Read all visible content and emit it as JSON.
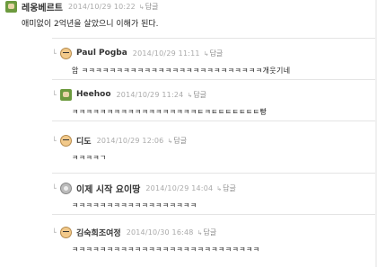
{
  "comments": {
    "top": {
      "nickname": "레옹베르트",
      "time": "2014/10/29 10:22",
      "reply_label": "답글",
      "text": "애미없이 2억년을 살았으니 이해가 된다."
    },
    "replies": [
      {
        "nickname": "Paul Pogba",
        "time": "2014/10/29 11:11",
        "reply_label": "답글",
        "text": "암 ㅋㅋㅋㅋㅋㅋㅋㅋㅋㅋㅋㅋㅋㅋㅋㅋㅋㅋㅋㅋㅋㅋㅋㅋㅋㅋ개웃기네"
      },
      {
        "nickname": "Heehoo",
        "time": "2014/10/29 11:24",
        "reply_label": "답글",
        "text": "ㅋㅋㅋㅋㅋㅋㅋㅋㅋㅋㅋㅋㅋㅋㅋㅋㅋㅋㅌㅋㅌㅌㅌㅌㅌㅌㅌ빵"
      },
      {
        "nickname": "디도",
        "time": "2014/10/29 12:06",
        "reply_label": "답글",
        "text": "ㅋㅋㅋㅋㄱ"
      },
      {
        "nickname": "이제 시작 요이땅",
        "time": "2014/10/29 14:04",
        "reply_label": "답글",
        "text": "ㅋㅋㅋㅋㅋㅋㅋㅋㅋㅋㅋㅋㅋㅋㅋㅋㅋㅋ"
      },
      {
        "nickname": "김숙희조여정",
        "time": "2014/10/30 16:48",
        "reply_label": "답글",
        "text": "ㅋㅋㅋㅋㅋㅋㅋㅋㅋㅋㅋㅋㅋㅋㅋㅋㅋㅋㅋㅋㅋㅋㅋㅋㅋㅋㅋ"
      }
    ]
  },
  "icons": {
    "reply_arrow": "reply-arrow-icon",
    "thread_elbow": "thread-elbow-icon"
  }
}
